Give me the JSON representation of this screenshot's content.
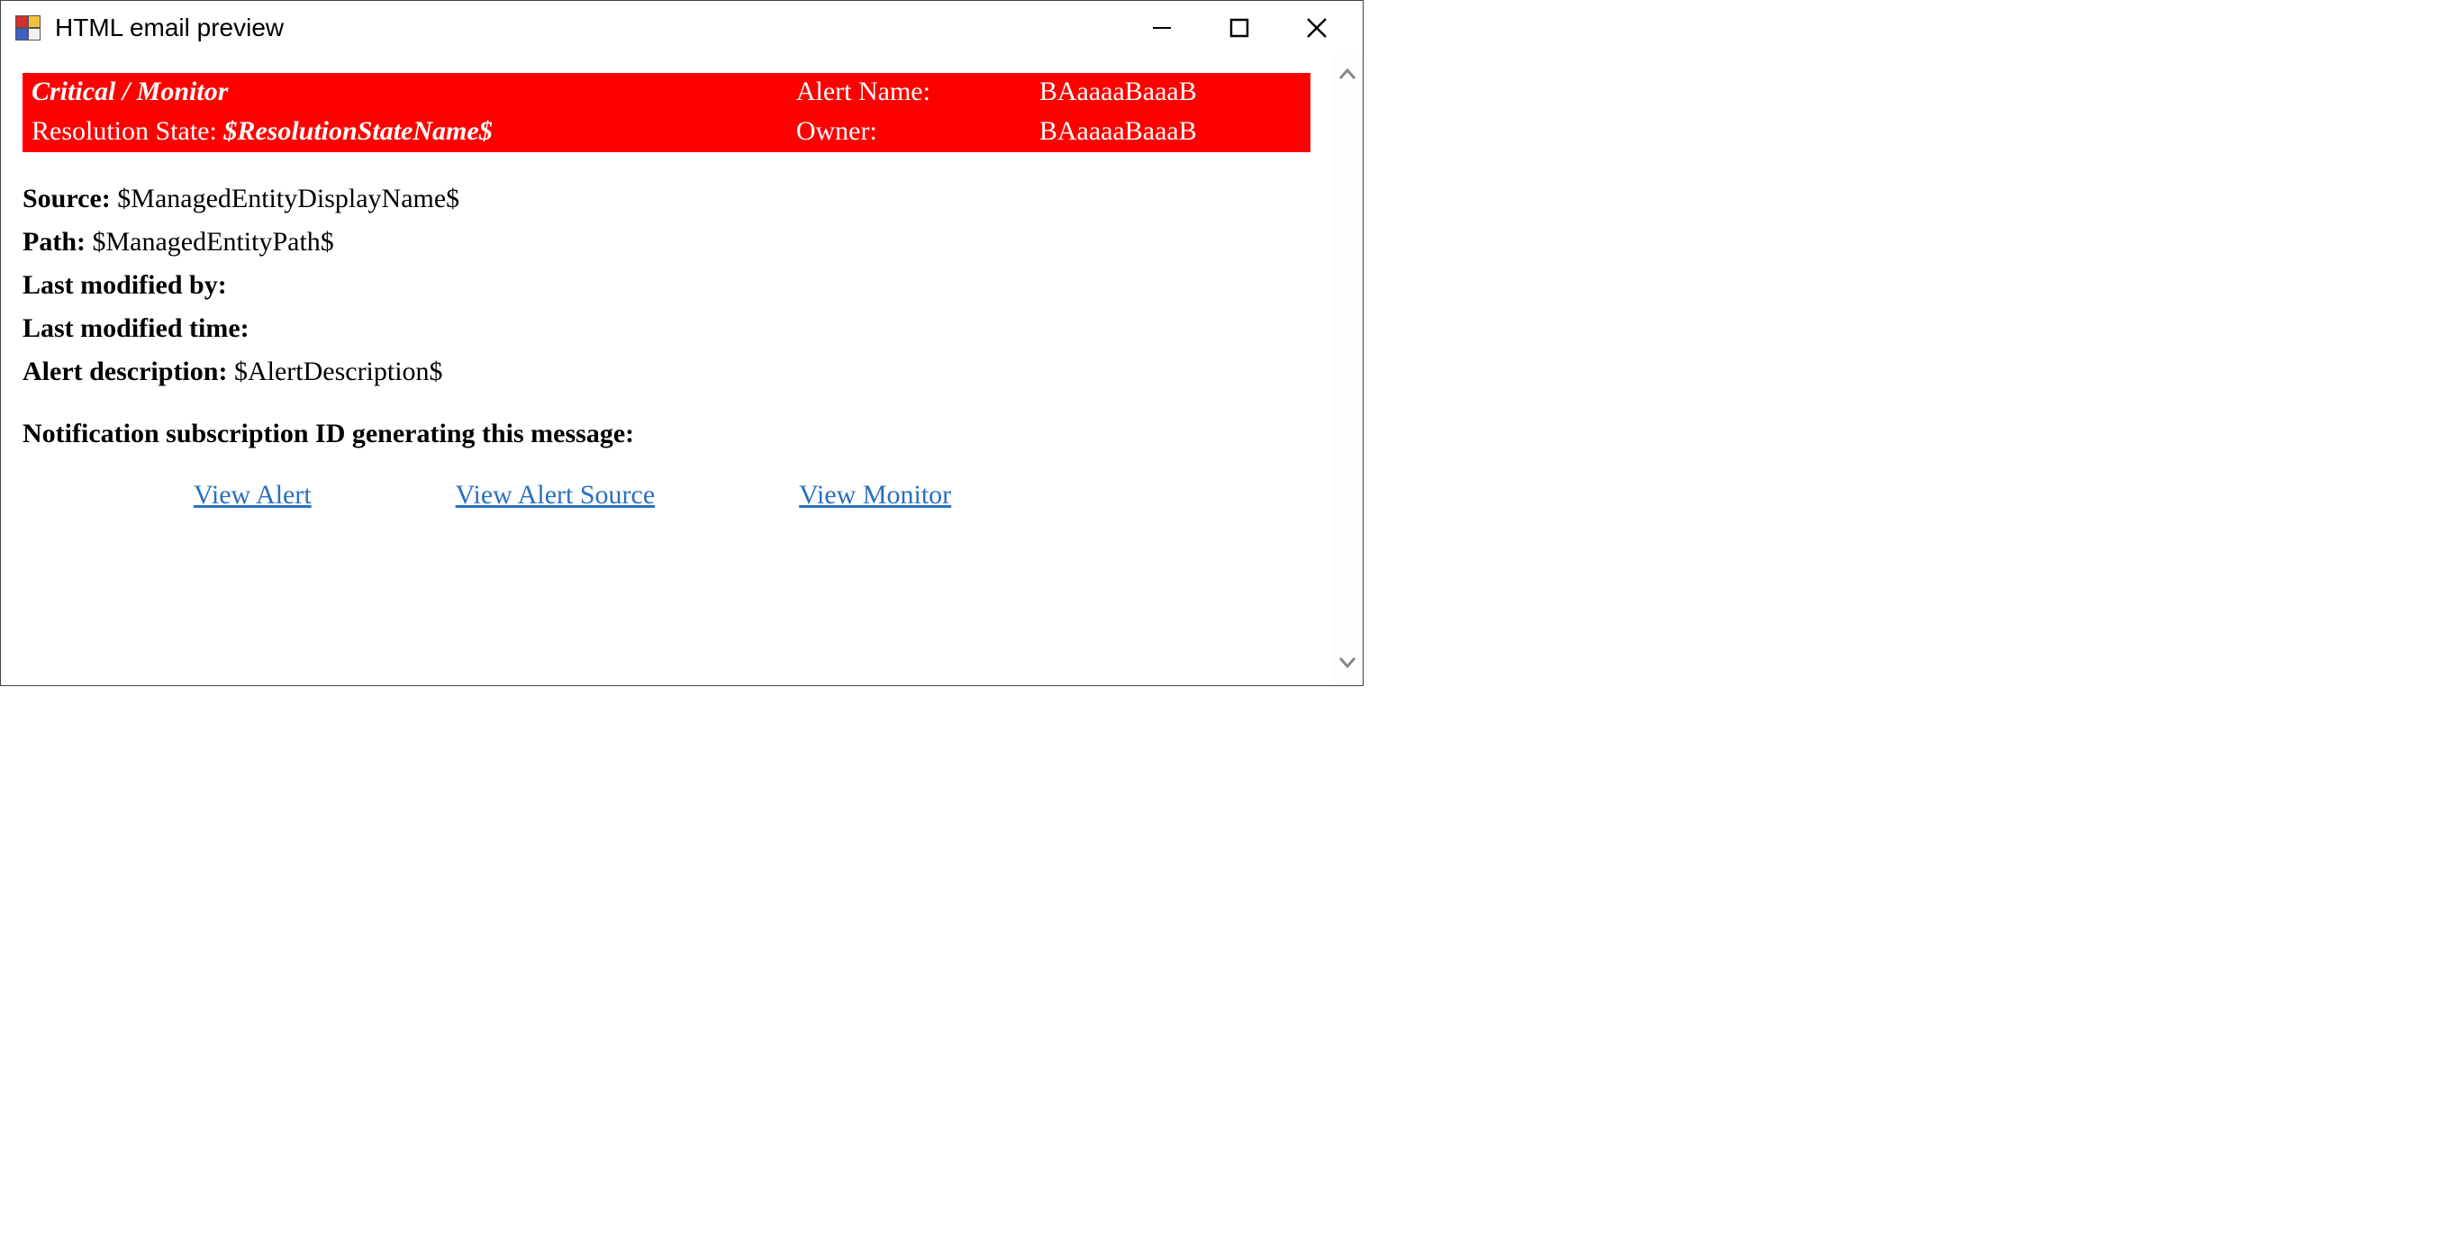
{
  "window": {
    "title": "HTML email preview"
  },
  "banner": {
    "severity": "Critical / Monitor",
    "alertNameLabel": "Alert Name:",
    "alertName": "BAaaaaBaaaB",
    "resolutionLabel": "Resolution State:",
    "resolutionValue": "$ResolutionStateName$",
    "ownerLabel": "Owner:",
    "ownerValue": "BAaaaaBaaaB"
  },
  "fields": {
    "sourceLabel": "Source:",
    "sourceValue": "$ManagedEntityDisplayName$",
    "pathLabel": "Path:",
    "pathValue": "$ManagedEntityPath$",
    "lastModByLabel": "Last modified by:",
    "lastModByValue": "",
    "lastModTimeLabel": "Last modified time:",
    "lastModTimeValue": "",
    "alertDescLabel": "Alert description:",
    "alertDescValue": "$AlertDescription$"
  },
  "subscription": {
    "label": "Notification subscription ID generating this message:",
    "value": ""
  },
  "links": {
    "viewAlert": "View Alert",
    "viewAlertSource": "View Alert Source",
    "viewMonitor": "View Monitor"
  }
}
